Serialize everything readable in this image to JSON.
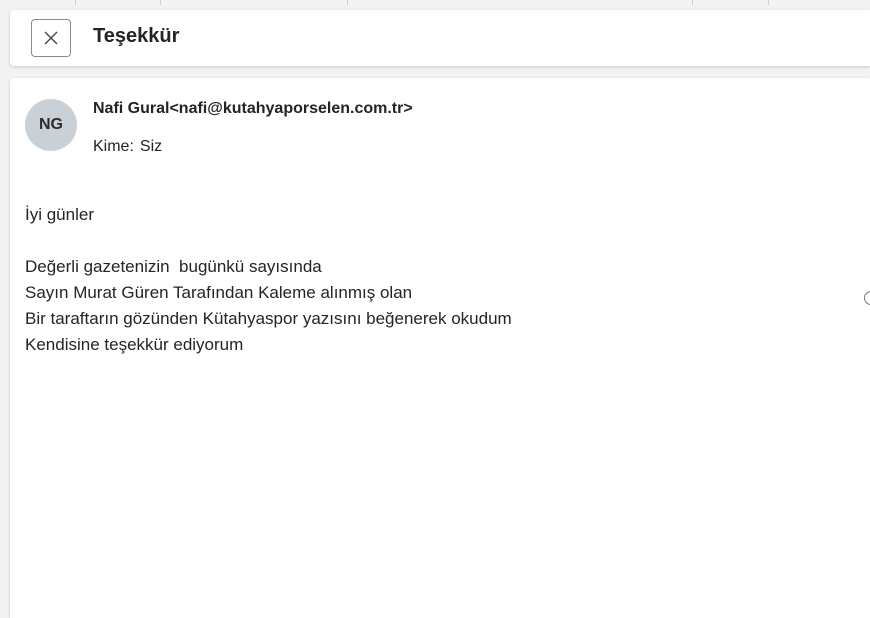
{
  "header": {
    "subject": "Teşekkür",
    "close_icon": "close-icon"
  },
  "message": {
    "avatar_initials": "NG",
    "sender": "Nafi Gural<nafi@kutahyaporselen.com.tr>",
    "to_label": "Kime:",
    "to_value": "Siz",
    "greeting": "İyi günler",
    "body_lines": [
      "Değerli gazetenizin  bugünkü sayısında",
      "Sayın Murat Güren Tarafından Kaleme alınmış olan",
      "Bir taraftarın gözünden Kütahyaspor yazısını beğenerek okudum",
      "Kendisine teşekkür ediyorum"
    ]
  },
  "colors": {
    "avatar_bg": "#c9d0d6",
    "page_bg": "#f3f3f3",
    "card_bg": "#ffffff"
  }
}
